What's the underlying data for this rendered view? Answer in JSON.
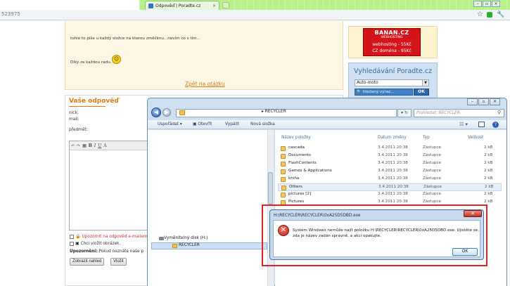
{
  "browser": {
    "tab_title": "Odpověď | Poradte.cz",
    "tab_close": "×",
    "address_fragment": "523975",
    "star": "☆",
    "win_min": "–",
    "win_max": "▫",
    "win_close": "×"
  },
  "messages": {
    "line1": "tohle to píše u každý složce na kterou změčknu...nevím co s tím...",
    "line2": "Díky za každou radu.",
    "smiley": "☺"
  },
  "page": {
    "back_link": "Zpět na otázku"
  },
  "form": {
    "title": "Vaše odpověď",
    "nick_label": "nick:",
    "mail_label": "mail:",
    "subject_label": "předmět:",
    "toolbar": [
      "↶",
      "↷",
      "▦",
      "B",
      "I",
      "U",
      "A"
    ],
    "checkbox_notify": "Upozornit na odpověď e-mailem",
    "checkbox_image": "Chci vložit obrázek.",
    "warning_bold": "Upozornění:",
    "warning_text": " Pokud neznáte naše p",
    "btn_preview": "Zobrazit nahled",
    "btn_insert": "Vložit"
  },
  "sidebar": {
    "banner_name": "BANAN.CZ",
    "banner_sub": "WEBHOSTING",
    "banner_line1": "webhosting - 55Kč",
    "banner_line2": "CZ doména - 95Kč",
    "search_title": "Vyhledávání Poradte.cz",
    "search_select": "Auto-moto",
    "search_input": "hledaný výraz...",
    "search_ok": "OK"
  },
  "explorer": {
    "path": "RECYCLER",
    "path_sep": "▸",
    "search_placeholder": "Prohledat: RECYCLER",
    "commands": {
      "organize": "Uspořádat ▾",
      "open": "Otevřít",
      "burn": "Vypálit",
      "new_folder": "Nová složka"
    },
    "columns": {
      "name": "Název položky",
      "date": "Datum změny",
      "type": "Typ",
      "size": "Velikost"
    },
    "rows": [
      {
        "name": "cascada",
        "date": "3.4.2011 20:38",
        "type": "Zástupce",
        "size": "2 kB"
      },
      {
        "name": "Documents",
        "date": "3.4.2011 20:38",
        "type": "Zástupce",
        "size": "2 kB"
      },
      {
        "name": "FlashContents",
        "date": "3.4.2011 20:38",
        "type": "Zástupce",
        "size": "2 kB"
      },
      {
        "name": "Games & Applications",
        "date": "3.4.2011 20:38",
        "type": "Zástupce",
        "size": "2 kB"
      },
      {
        "name": "kniha",
        "date": "3.4.2011 20:38",
        "type": "Zástupce",
        "size": "2 kB"
      },
      {
        "name": "Others",
        "date": "3.4.2011 20:38",
        "type": "Zástupce",
        "size": "2 kB"
      },
      {
        "name": "pictures [2]",
        "date": "3.4.2011 20:38",
        "type": "Zástupce",
        "size": "2 kB"
      },
      {
        "name": "Pictures",
        "date": "3.4.2011 20:38",
        "type": "Zástupce",
        "size": "2 kB"
      }
    ],
    "nav_drive": "Vyměnitelný disk (H:)",
    "nav_folder": "RECYCLER"
  },
  "dialog": {
    "title": "H:\\RECYCLER\\RECYCLER\\0xA25D5DBD.exe",
    "message_line1": "Systém Windows nemůže najít položku H:\\RECYCLER\\RECYCLER\\0xA25D5DBD.exe. Ujistěte se,",
    "message_line2": "zda je název zadán správně, a akci opakujte.",
    "ok": "OK",
    "close": "✕"
  }
}
